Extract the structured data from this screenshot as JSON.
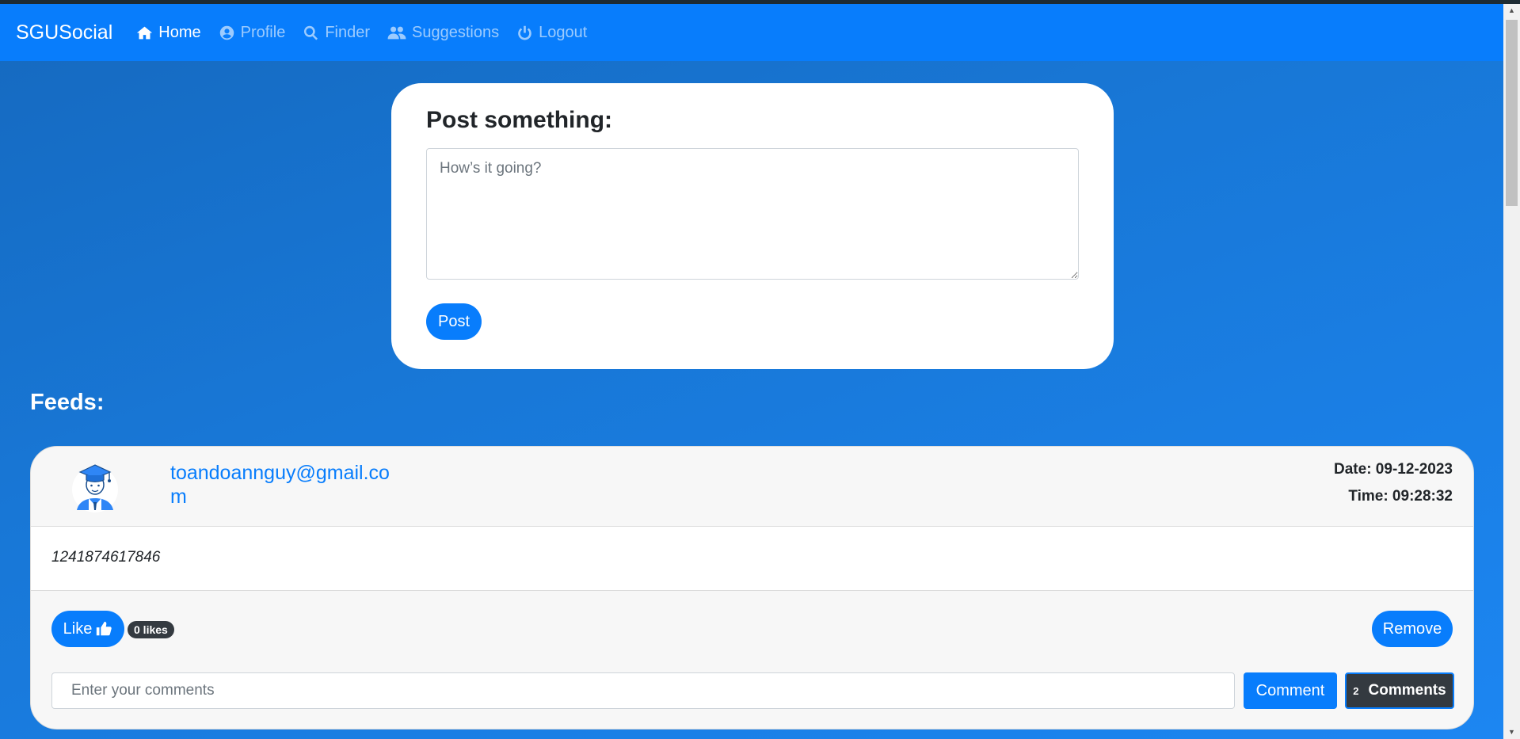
{
  "navbar": {
    "brand": "SGUSocial",
    "items": [
      {
        "label": "Home",
        "icon": "home-icon"
      },
      {
        "label": "Profile",
        "icon": "user-circle-icon"
      },
      {
        "label": "Finder",
        "icon": "search-icon"
      },
      {
        "label": "Suggestions",
        "icon": "users-icon"
      },
      {
        "label": "Logout",
        "icon": "power-icon"
      }
    ],
    "active": "Home"
  },
  "post_form": {
    "title": "Post something:",
    "placeholder": "How’s it going?",
    "button_label": "Post"
  },
  "feeds": {
    "title": "Feeds:",
    "items": [
      {
        "author": "toandoannguy@gmail.com",
        "date": "Date: 09-12-2023",
        "time": "Time: 09:28:32",
        "content": "1241874617846",
        "like_label": "Like",
        "likes": "0 likes",
        "remove_label": "Remove",
        "comment_placeholder": "Enter your comments",
        "comment_label": "Comment",
        "comments_count": "2",
        "comments_label": "Comments"
      }
    ]
  },
  "colors": {
    "primary": "#087dfc",
    "dark": "#343a40",
    "background": "#1877d6"
  }
}
